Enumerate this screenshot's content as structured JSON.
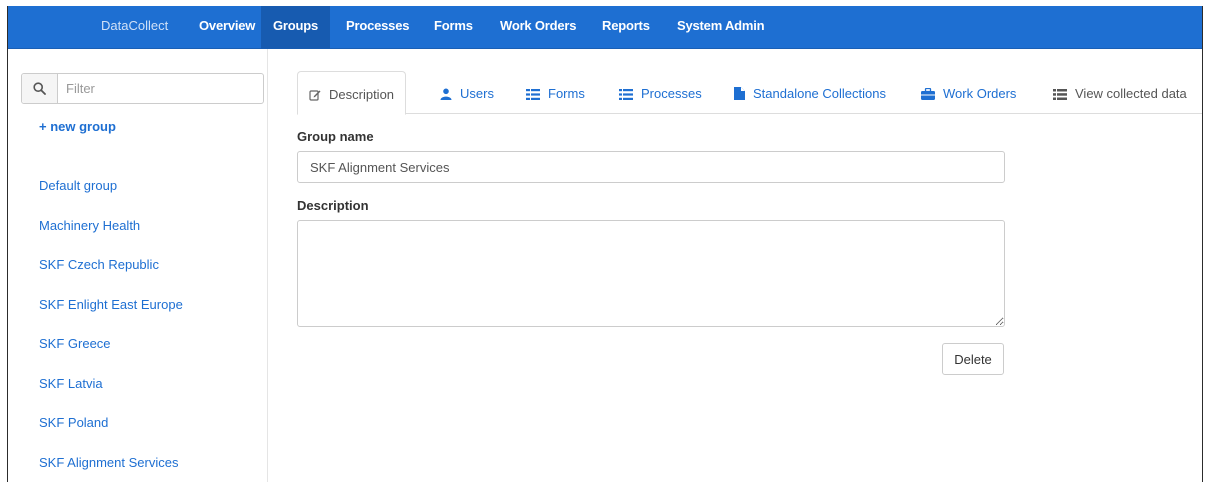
{
  "navbar": {
    "brand": "DataCollect",
    "items": [
      {
        "label": "Overview",
        "active": false
      },
      {
        "label": "Groups",
        "active": true
      },
      {
        "label": "Processes",
        "active": false
      },
      {
        "label": "Forms",
        "active": false
      },
      {
        "label": "Work Orders",
        "active": false
      },
      {
        "label": "Reports",
        "active": false
      },
      {
        "label": "System Admin",
        "active": false
      }
    ],
    "colors": {
      "background": "#1e6fd2",
      "active": "#175bb0"
    }
  },
  "sidebar": {
    "filter": {
      "placeholder": "Filter",
      "value": "",
      "icon": "search-icon"
    },
    "new_group_label": "+ new group",
    "groups": [
      "Default group",
      "Machinery Health",
      "SKF Czech Republic",
      "SKF Enlight East Europe",
      "SKF Greece",
      "SKF Latvia",
      "SKF Poland",
      "SKF Alignment Services"
    ]
  },
  "tabs": [
    {
      "label": "Description",
      "icon": "edit-icon",
      "active": true
    },
    {
      "label": "Users",
      "icon": "user-icon",
      "active": false
    },
    {
      "label": "Forms",
      "icon": "forms-icon",
      "active": false
    },
    {
      "label": "Processes",
      "icon": "list-icon",
      "active": false
    },
    {
      "label": "Standalone Collections",
      "icon": "file-icon",
      "active": false
    },
    {
      "label": "Work Orders",
      "icon": "briefcase-icon",
      "active": false
    },
    {
      "label": "View collected data",
      "icon": "th-list-icon",
      "active": false
    }
  ],
  "form": {
    "group_name_label": "Group name",
    "group_name_value": "SKF Alignment Services",
    "description_label": "Description",
    "description_value": "",
    "delete_label": "Delete"
  }
}
